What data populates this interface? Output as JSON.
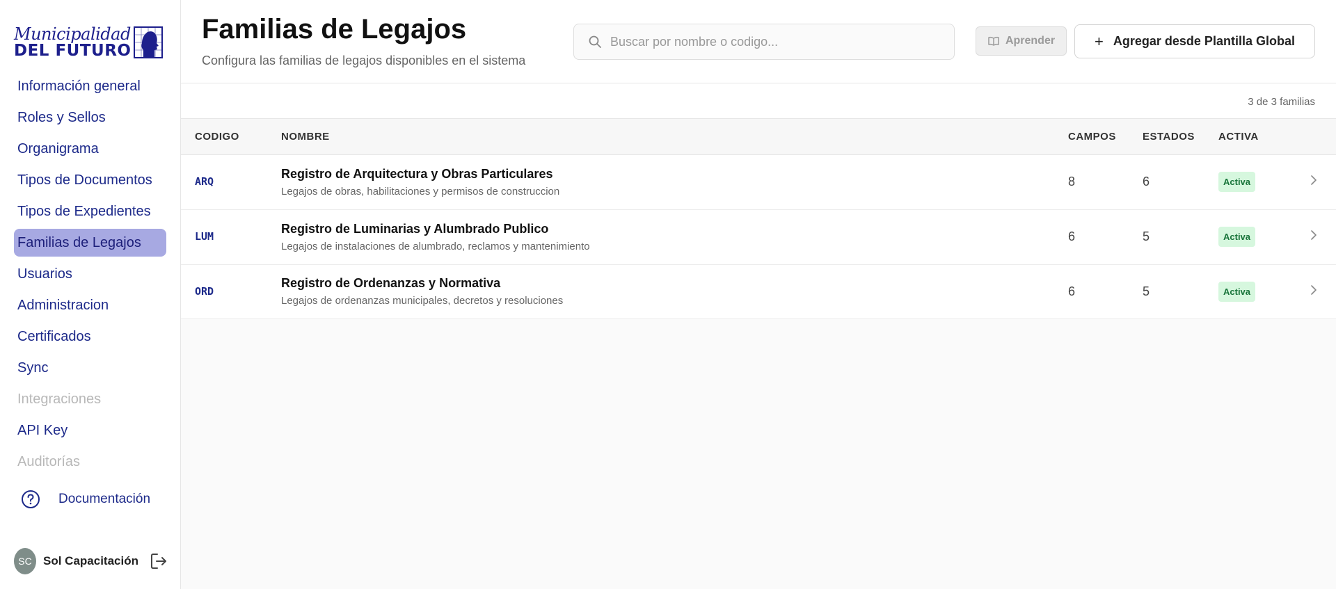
{
  "logo": {
    "script_text": "Municipalidad",
    "bold_text": "DEL FUTURO"
  },
  "sidebar": {
    "items": [
      {
        "label": "Información general",
        "state": "normal"
      },
      {
        "label": "Roles y Sellos",
        "state": "normal"
      },
      {
        "label": "Organigrama",
        "state": "normal"
      },
      {
        "label": "Tipos de Documentos",
        "state": "normal"
      },
      {
        "label": "Tipos de Expedientes",
        "state": "normal"
      },
      {
        "label": "Familias de Legajos",
        "state": "active"
      },
      {
        "label": "Usuarios",
        "state": "normal"
      },
      {
        "label": "Administracion",
        "state": "normal"
      },
      {
        "label": "Certificados",
        "state": "normal"
      },
      {
        "label": "Sync",
        "state": "normal"
      },
      {
        "label": "Integraciones",
        "state": "disabled"
      },
      {
        "label": "API Key",
        "state": "normal"
      },
      {
        "label": "Auditorías",
        "state": "disabled"
      }
    ],
    "docs_label": "Documentación",
    "user": {
      "initials": "SC",
      "name": "Sol Capacitación"
    }
  },
  "header": {
    "title": "Familias de Legajos",
    "subtitle": "Configura las familias de legajos disponibles en el sistema",
    "search_placeholder": "Buscar por nombre o codigo...",
    "learn_label": "Aprender",
    "add_label": "Agregar desde Plantilla Global"
  },
  "count_label": "3 de 3 familias",
  "table": {
    "columns": {
      "codigo": "CODIGO",
      "nombre": "NOMBRE",
      "campos": "CAMPOS",
      "estados": "ESTADOS",
      "activa": "ACTIVA"
    },
    "rows": [
      {
        "code": "ARQ",
        "name": "Registro de Arquitectura y Obras Particulares",
        "desc": "Legajos de obras, habilitaciones y permisos de construccion",
        "campos": "8",
        "estados": "6",
        "status": "Activa"
      },
      {
        "code": "LUM",
        "name": "Registro de Luminarias y Alumbrado Publico",
        "desc": "Legajos de instalaciones de alumbrado, reclamos y mantenimiento",
        "campos": "6",
        "estados": "5",
        "status": "Activa"
      },
      {
        "code": "ORD",
        "name": "Registro de Ordenanzas y Normativa",
        "desc": "Legajos de ordenanzas municipales, decretos y resoluciones",
        "campos": "6",
        "estados": "5",
        "status": "Activa"
      }
    ]
  },
  "colors": {
    "brand": "#1d1f8c",
    "nav_text": "#1d2a8a",
    "active_bg": "#a7a9e2",
    "badge_bg": "#d6f7de",
    "badge_text": "#18743a"
  }
}
